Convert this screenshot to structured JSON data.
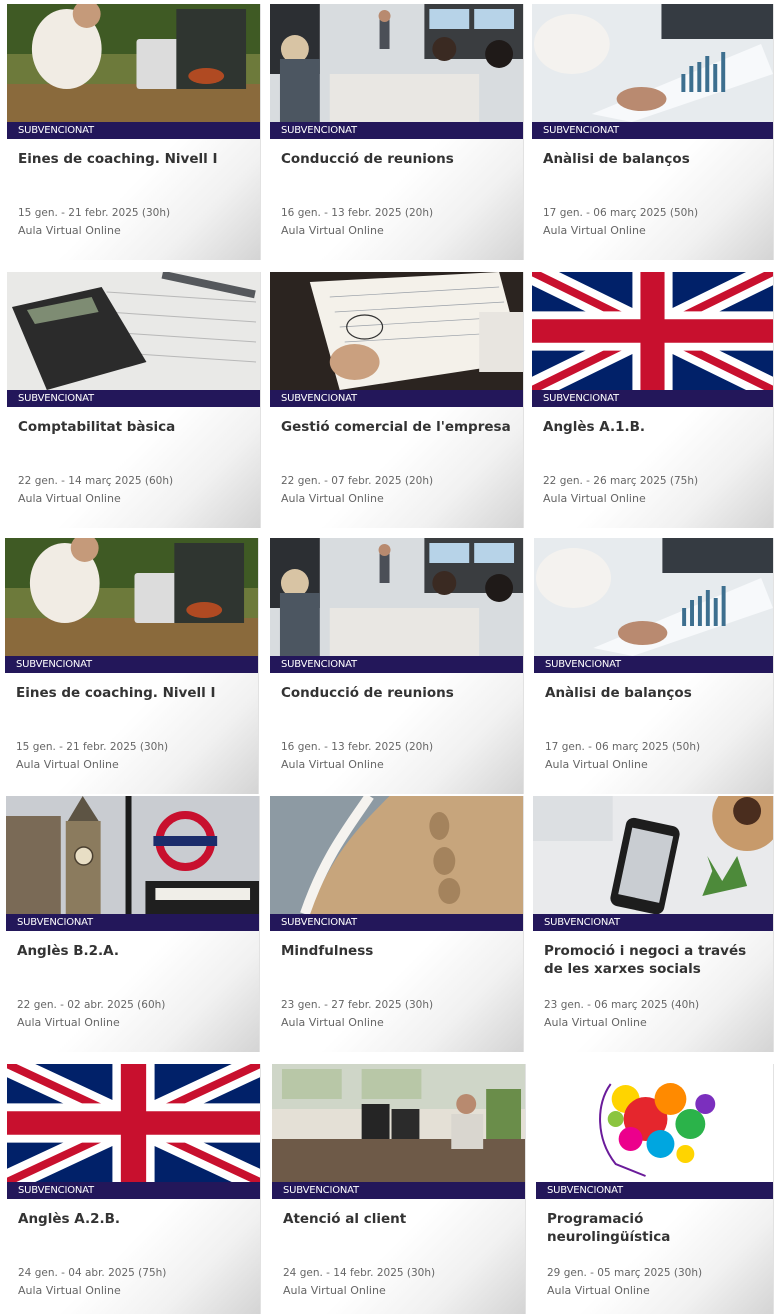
{
  "courses": [
    {
      "badge": "SUBVENCIONAT",
      "title": "Eines de coaching. Nivell I",
      "dates": "15 gen. - 21 febr. 2025 (30h)",
      "place": "Aula Virtual Online",
      "image": "coaching-photo"
    },
    {
      "badge": "SUBVENCIONAT",
      "title": "Conducció de reunions",
      "dates": "16 gen. - 13 febr. 2025 (20h)",
      "place": "Aula Virtual Online",
      "image": "meeting-photo"
    },
    {
      "badge": "SUBVENCIONAT",
      "title": "Anàlisi de balanços",
      "dates": "17 gen. - 06 març 2025 (50h)",
      "place": "Aula Virtual Online",
      "image": "charts-photo"
    },
    {
      "badge": "SUBVENCIONAT",
      "title": "Comptabilitat bàsica",
      "dates": "22 gen. - 14 març 2025 (60h)",
      "place": "Aula Virtual Online",
      "image": "calculator-photo"
    },
    {
      "badge": "SUBVENCIONAT",
      "title": "Gestió comercial de l'empresa",
      "dates": "22 gen. - 07 febr. 2025 (20h)",
      "place": "Aula Virtual Online",
      "image": "notebook-photo"
    },
    {
      "badge": "SUBVENCIONAT",
      "title": "Anglès A.1.B.",
      "dates": "22 gen. - 26 març 2025 (75h)",
      "place": "Aula Virtual Online",
      "image": "uk-flag"
    },
    {
      "badge": "SUBVENCIONAT",
      "title": "Eines de coaching. Nivell I",
      "dates": "15 gen. - 21 febr. 2025 (30h)",
      "place": "Aula Virtual Online",
      "image": "coaching-photo"
    },
    {
      "badge": "SUBVENCIONAT",
      "title": "Conducció de reunions",
      "dates": "16 gen. - 13 febr. 2025 (20h)",
      "place": "Aula Virtual Online",
      "image": "meeting-photo"
    },
    {
      "badge": "SUBVENCIONAT",
      "title": "Anàlisi de balanços",
      "dates": "17 gen. - 06 març 2025 (50h)",
      "place": "Aula Virtual Online",
      "image": "charts-photo"
    },
    {
      "badge": "SUBVENCIONAT",
      "title": "Anglès B.2.A.",
      "dates": "22 gen. - 02 abr. 2025 (60h)",
      "place": "Aula Virtual Online",
      "image": "london-photo"
    },
    {
      "badge": "SUBVENCIONAT",
      "title": "Mindfulness",
      "dates": "23 gen. - 27 febr. 2025 (30h)",
      "place": "Aula Virtual Online",
      "image": "beach-photo"
    },
    {
      "badge": "SUBVENCIONAT",
      "title": "Promoció i negoci a través de les xarxes socials",
      "dates": "23 gen. - 06 març 2025 (40h)",
      "place": "Aula Virtual Online",
      "image": "phone-photo"
    },
    {
      "badge": "SUBVENCIONAT",
      "title": "Anglès A.2.B.",
      "dates": "24 gen. - 04 abr. 2025 (75h)",
      "place": "Aula Virtual Online",
      "image": "uk-flag"
    },
    {
      "badge": "SUBVENCIONAT",
      "title": "Atenció al client",
      "dates": "24 gen. - 14 febr. 2025 (30h)",
      "place": "Aula Virtual Online",
      "image": "callcenter-photo"
    },
    {
      "badge": "SUBVENCIONAT",
      "title": "Programació neurolingüística",
      "dates": "29 gen. - 05 març 2025 (30h)",
      "place": "Aula Virtual Online",
      "image": "colorful-head-illustration"
    }
  ]
}
